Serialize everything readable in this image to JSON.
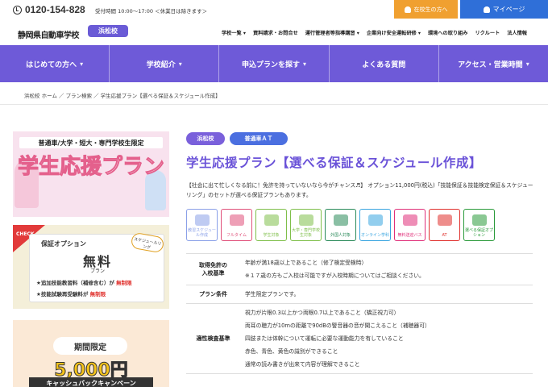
{
  "topbar": {
    "phone": "0120-154-828",
    "hours": "受付時間 10:00〜17:00 ＜休業日は除きます＞",
    "student_button": "在校生の方へ",
    "mypage_button": "マイページ"
  },
  "header": {
    "logo": "静岡県自動車学校",
    "branch": "浜松校",
    "nav": [
      "学校一覧 ▾",
      "資料請求・お問合せ",
      "運行管理者等指導講習 ▾",
      "企業向け安全運転研修 ▾",
      "環境への取り組み",
      "リクルート",
      "法人情報"
    ]
  },
  "mainnav": {
    "items": [
      {
        "label": "はじめての方へ",
        "chev": "▾"
      },
      {
        "label": "学校紹介",
        "chev": "▾"
      },
      {
        "label": "申込プランを探す",
        "chev": "▾"
      },
      {
        "label": "よくある質問",
        "chev": ""
      },
      {
        "label": "アクセス・営業時間",
        "chev": "▾"
      }
    ]
  },
  "breadcrumb": "浜松校 ホーム ／ プラン検索 ／ 学生応援プラン【選べる保証＆スケジュール作成】",
  "banners": {
    "b1_top": "普通車/大学・短大・専門学校生限定",
    "b1_main": "学生応援プラン",
    "b2_check": "CHECK",
    "b2_sub": "保証オプション",
    "b2_title": "無料",
    "b2_plan": "プラン",
    "b2_line1_a": "★追加技能教習料（補修含む）が",
    "b2_line1_b": "無制限",
    "b2_line2_a": "★技能試験再受験料が",
    "b2_line2_b": "無制限",
    "b2_sched": "スケジュールリング",
    "b3_limited": "期間限定",
    "b3_amount": "5,000円",
    "b3_cash": "キャッシュバックキャンペーン"
  },
  "main": {
    "tags": [
      "浜松校",
      "普通車ＡＴ"
    ],
    "title": "学生応援プラン【選べる保証＆スケジュール作成】",
    "desc": "【社会に出て忙しくなる前に！免許を持っていないなら今がチャンス♬】 オプション11,000円(税込)「技能保証＆技能検定保証＆スケジューリング」のセットが選べる保証プランもあります。",
    "icons": [
      {
        "label": "教習スケジュール作成",
        "color": "#8aa0e8"
      },
      {
        "label": "フルタイム",
        "color": "#e0507a"
      },
      {
        "label": "学生対象",
        "color": "#7fbf4a"
      },
      {
        "label": "大学・専門学校生対象",
        "color": "#7fbf4a"
      },
      {
        "label": "外国人対象",
        "color": "#2a8a5a"
      },
      {
        "label": "オンライン学科",
        "color": "#39a5e0"
      },
      {
        "label": "無料送迎バス",
        "color": "#e0307a"
      },
      {
        "label": "AT",
        "color": "#e0302c"
      },
      {
        "label": "選べる保証オプション",
        "color": "#2a9a3a"
      }
    ],
    "table": [
      {
        "head": "取得免許の\n入校基準",
        "lines": [
          "年齢が満18歳以上であること（修了検定受検時）",
          "※１７歳の方もご入校は可能ですが入校時期についてはご相談ください。"
        ]
      },
      {
        "head": "プラン条件",
        "lines": [
          "学生限定プランです。"
        ]
      },
      {
        "head": "適性検査基準",
        "lines": [
          "視力が片眼0.3以上かつ両眼0.7以上であること（矯正視力可）",
          "両耳の聴力が10mの距離で90dBの警音器の音が聞こえること（補聴器可）",
          "四肢または体幹について運転に必要な運動能力を有していること",
          "赤色、青色、黄色の識別ができること",
          "通常の読み書きが出来て内容が理解できること"
        ]
      }
    ]
  }
}
